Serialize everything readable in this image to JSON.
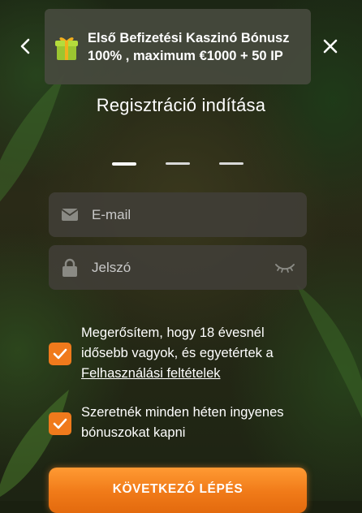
{
  "banner": {
    "text": "Első Befizetési Kaszinó Bónusz 100% , maximum €1000 + 50 IP",
    "icon": "gift-icon"
  },
  "nav": {
    "prev_icon": "chevron-left-icon",
    "close_icon": "close-icon"
  },
  "title": "Regisztráció indítása",
  "steps": {
    "total": 3,
    "current": 1
  },
  "form": {
    "email": {
      "placeholder": "E-mail",
      "value": "",
      "icon": "mail-icon"
    },
    "password": {
      "placeholder": "Jelszó",
      "value": "",
      "icon": "lock-icon",
      "toggle_icon": "eye-closed-icon"
    }
  },
  "consents": [
    {
      "checked": true,
      "text": "Megerősítem, hogy 18 évesnél idősebb vagyok, és egyetértek a ",
      "link": "Felhasználási feltételek"
    },
    {
      "checked": true,
      "text": "Szeretnék minden héten ingyenes bónuszokat kapni"
    }
  ],
  "next_button": {
    "label": "KÖVETKEZŐ LÉPÉS"
  },
  "colors": {
    "accent": "#f07a1c",
    "field_bg": "#403e36",
    "banner_bg": "#464a3e"
  }
}
